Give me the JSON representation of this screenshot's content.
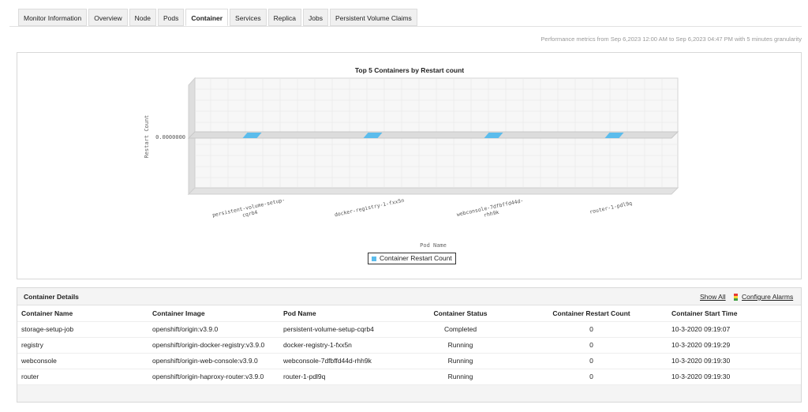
{
  "tabs": [
    {
      "label": "Monitor Information",
      "active": false
    },
    {
      "label": "Overview",
      "active": false
    },
    {
      "label": "Node",
      "active": false
    },
    {
      "label": "Pods",
      "active": false
    },
    {
      "label": "Container",
      "active": true
    },
    {
      "label": "Services",
      "active": false
    },
    {
      "label": "Replica",
      "active": false
    },
    {
      "label": "Jobs",
      "active": false
    },
    {
      "label": "Persistent Volume Claims",
      "active": false
    }
  ],
  "perf_note": "Performance metrics from Sep 6,2023 12:00 AM to Sep 6,2023 04:47 PM with 5 minutes granularity",
  "chart_data": {
    "type": "bar",
    "title": "Top 5 Containers by Restart count",
    "xlabel": "Pod Name",
    "ylabel": "Restart Count",
    "y_tick_labels": [
      "0.0000000"
    ],
    "categories": [
      "persistent-volume-setup-cqrb4",
      "docker-registry-1-fxx5n",
      "webconsole-7dfbffd44d-rhh9k",
      "router-1-pdl9q"
    ],
    "category_labels": [
      [
        "persistent-volume-setup-",
        "cqrb4"
      ],
      [
        "docker-registry-1-fxx5n"
      ],
      [
        "webconsole-7dfbffd44d-",
        "rhh9k"
      ],
      [
        "router-1-pdl9q"
      ]
    ],
    "series": [
      {
        "name": "Container Restart Count",
        "values": [
          0,
          0,
          0,
          0
        ]
      }
    ],
    "colors": {
      "bar": "#5bbcec"
    },
    "grid": true,
    "legend": "bottom"
  },
  "details": {
    "title": "Container Details",
    "show_all": "Show All",
    "configure_alarms": "Configure Alarms",
    "columns": [
      "Container Name",
      "Container Image",
      "Pod Name",
      "Container Status",
      "Container Restart Count",
      "Container Start Time"
    ],
    "rows": [
      [
        "storage-setup-job",
        "openshift/origin:v3.9.0",
        "persistent-volume-setup-cqrb4",
        "Completed",
        "0",
        "10-3-2020 09:19:07"
      ],
      [
        "registry",
        "openshift/origin-docker-registry:v3.9.0",
        "docker-registry-1-fxx5n",
        "Running",
        "0",
        "10-3-2020 09:19:29"
      ],
      [
        "webconsole",
        "openshift/origin-web-console:v3.9.0",
        "webconsole-7dfbffd44d-rhh9k",
        "Running",
        "0",
        "10-3-2020 09:19:30"
      ],
      [
        "router",
        "openshift/origin-haproxy-router:v3.9.0",
        "router-1-pdl9q",
        "Running",
        "0",
        "10-3-2020 09:19:30"
      ]
    ]
  }
}
